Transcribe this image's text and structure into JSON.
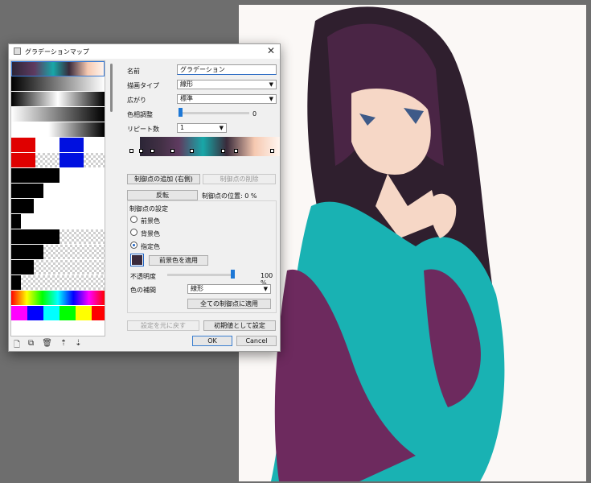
{
  "dialog": {
    "title": "グラデーションマップ",
    "close_glyph": "✕",
    "name_label": "名前",
    "name_value": "グラデーション",
    "draw_type_label": "描画タイプ",
    "draw_type_value": "線形",
    "spread_label": "広がり",
    "spread_value": "標準",
    "hue_label": "色相調整",
    "hue_value": "0",
    "repeat_label": "リピート数",
    "repeat_value": "1",
    "add_stop_button": "制御点の追加 (右側)",
    "delete_stop_button": "制御点の削除",
    "reverse_button": "反転",
    "stop_position_label": "制御点の位置: 0 %",
    "stop_settings_label": "制御点の設定",
    "radio_fg": "前景色",
    "radio_bg": "背景色",
    "radio_custom": "指定色",
    "apply_fg_button": "前景色を適用",
    "opacity_label": "不透明度",
    "opacity_value": "100 %",
    "interp_label": "色の補間",
    "interp_value": "線形",
    "apply_all_button": "全ての制御点に適用",
    "reset_button": "設定を元に戻す",
    "set_default_button": "初期値として設定",
    "ok_button": "OK",
    "cancel_button": "Cancel",
    "custom_color": "#3a2a3c",
    "accent_color": "#1e78d6"
  },
  "preset_icons": [
    "new-icon",
    "duplicate-icon",
    "delete-icon",
    "import-icon",
    "export-icon"
  ]
}
